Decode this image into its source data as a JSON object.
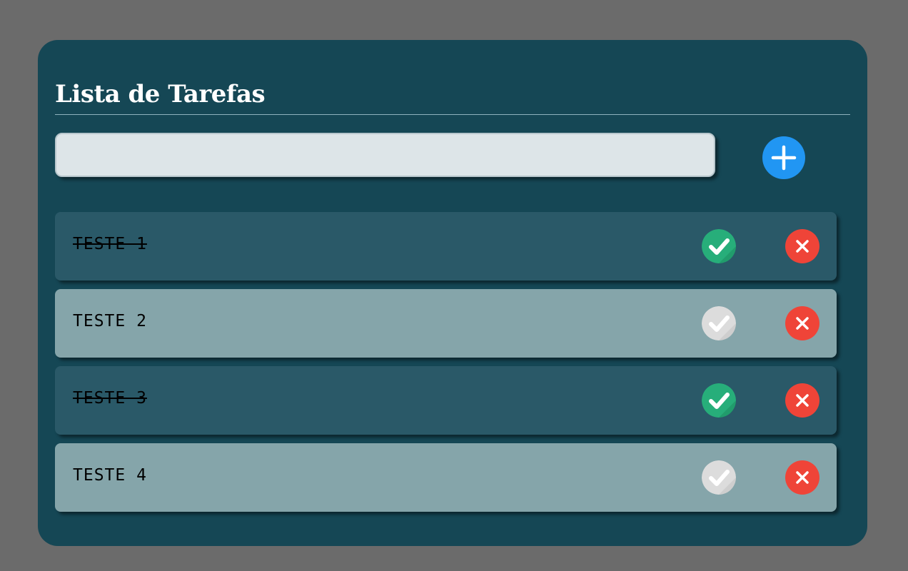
{
  "app": {
    "title": "Lista de Tarefas"
  },
  "input": {
    "value": "",
    "placeholder": ""
  },
  "add_button": {
    "icon": "plus-icon",
    "color": "#2196f3"
  },
  "colors": {
    "background": "#6b6b6b",
    "card": "#154755",
    "task_done": "#2a5968",
    "task_pending": "#85a5aa",
    "check_done": "#27ae7a",
    "check_pending": "#dcdcdc",
    "delete": "#ef4438"
  },
  "tasks": [
    {
      "label": "TESTE 1",
      "done": true
    },
    {
      "label": "TESTE 2",
      "done": false
    },
    {
      "label": "TESTE 3",
      "done": true
    },
    {
      "label": "TESTE 4",
      "done": false
    }
  ]
}
